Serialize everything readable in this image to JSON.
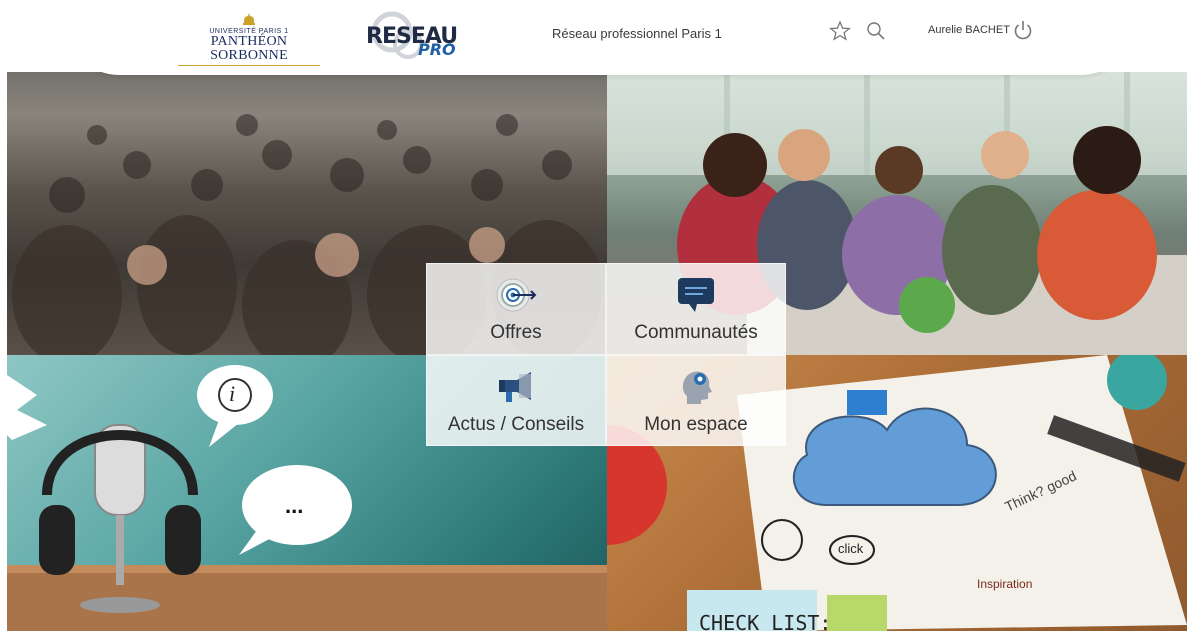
{
  "header": {
    "university_small": "UNIVERSITÉ PARIS 1",
    "university_big": "PANTHÉON SORBONNE",
    "brand_line1": "RESEAU",
    "brand_line2": "PRO",
    "site_title": "Réseau professionnel Paris 1",
    "user_name": "Aurelie BACHET",
    "icons": [
      "star-icon",
      "search-icon",
      "power-icon"
    ]
  },
  "menu": {
    "items": [
      {
        "label": "Offres",
        "icon": "target-icon"
      },
      {
        "label": "Communautés",
        "icon": "chat-bubble-icon"
      },
      {
        "label": "Actus / Conseils",
        "icon": "megaphone-icon"
      },
      {
        "label": "Mon espace",
        "icon": "user-head-icon"
      }
    ]
  },
  "tiles": {
    "podcast_bubble_info": "i",
    "podcast_bubble_dots": "...",
    "desk_note": "CHECK LIST:",
    "desk_bubble": "click",
    "desk_scribble": "Think? good",
    "desk_inspiration": "Inspiration"
  },
  "colors": {
    "brand_navy": "#1a2b5e",
    "accent_blue": "#2b6cb0",
    "gold": "#c9a227"
  }
}
